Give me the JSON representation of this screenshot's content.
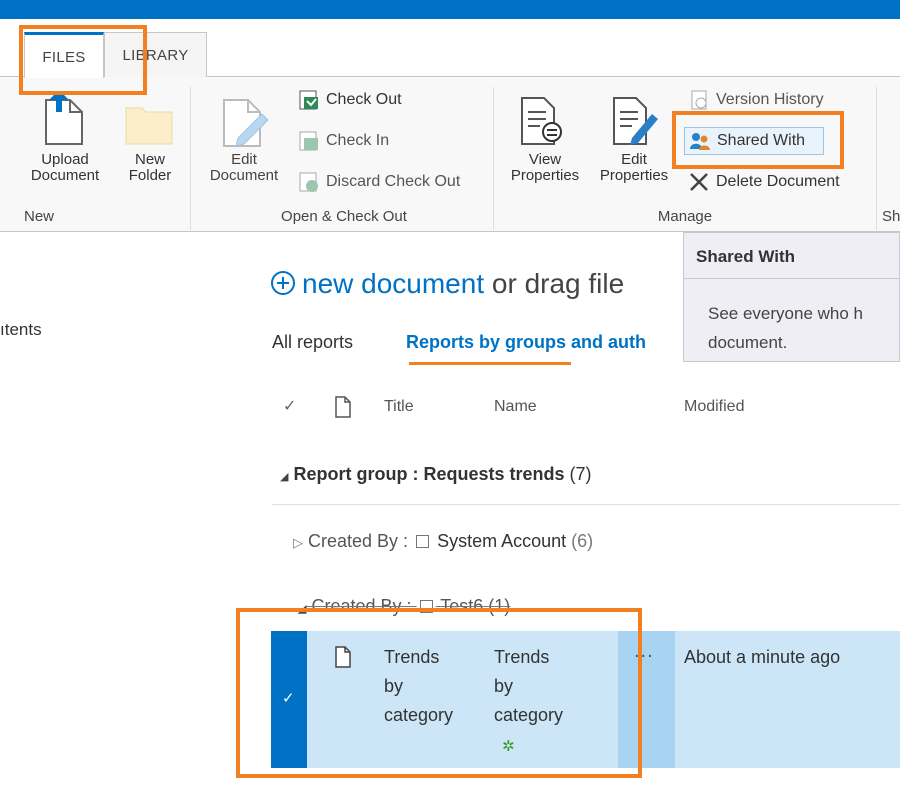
{
  "ribbon": {
    "tabs": [
      {
        "label": "FILES"
      },
      {
        "label": "LIBRARY"
      }
    ],
    "groups": {
      "new": {
        "label": "New",
        "upload_document": "Upload Document",
        "new_folder": "New Folder"
      },
      "open_checkout": {
        "label": "Open & Check Out",
        "edit_document": "Edit Document",
        "check_out": "Check Out",
        "check_in": "Check In",
        "discard_check_out": "Discard Check Out"
      },
      "manage": {
        "label": "Manage",
        "view_properties": "View Properties",
        "edit_properties": "Edit Properties",
        "version_history": "Version History",
        "shared_with": "Shared With",
        "delete_document": "Delete Document"
      },
      "share_partial_label": "Sh"
    }
  },
  "tooltip": {
    "title": "Shared With",
    "body_line1": "See everyone who h",
    "body_line2": "document."
  },
  "sidebar": {
    "contents_partial": "ıtents"
  },
  "main": {
    "new_document_link": "new document",
    "new_document_rest": " or drag file",
    "views": {
      "all": "All reports",
      "groups": "Reports by groups and auth"
    },
    "columns": {
      "title": "Title",
      "name": "Name",
      "modified": "Modified"
    },
    "group1": {
      "label": "Report group : Requests trends",
      "count": "(7)"
    },
    "subgroup_system": {
      "prefix": "Created By :",
      "name": "System Account",
      "count": "(6)"
    },
    "subgroup_test6": {
      "prefix": "Created By :",
      "name": "Test6",
      "count": "(1)"
    },
    "row": {
      "title_lines": [
        "Trends",
        "by",
        "category"
      ],
      "name_lines": [
        "Trends",
        "by",
        "category"
      ],
      "ellipsis": "...",
      "modified": "About a minute ago"
    }
  },
  "colors": {
    "accent": "#0072c6",
    "highlight_orange": "#f28020",
    "selected_row": "#cde6f7"
  }
}
